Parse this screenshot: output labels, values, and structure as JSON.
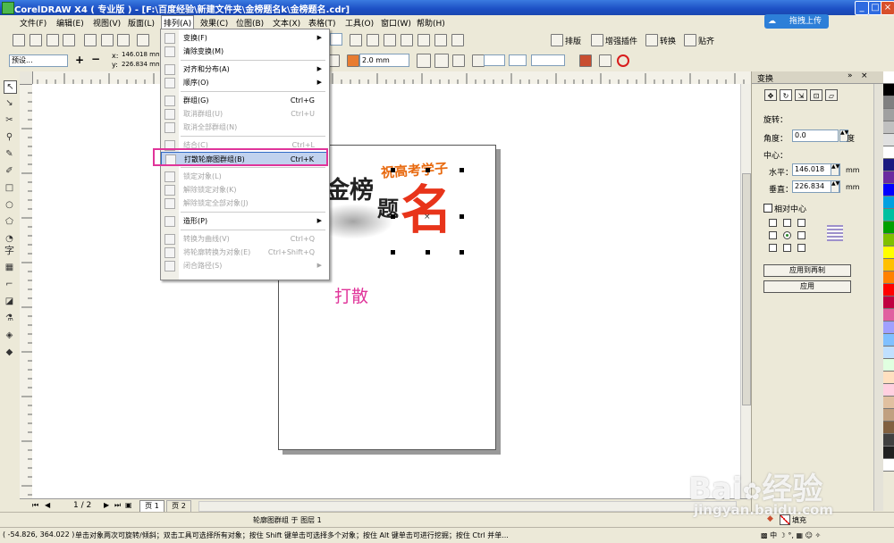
{
  "window": {
    "title": "CorelDRAW X4 ( 专业版 ) - [F:\\百度经验\\新建文件夹\\金榜题名k\\金榜题名.cdr]",
    "upload_label": "拖拽上传"
  },
  "menubar": [
    {
      "label": "文件(F)"
    },
    {
      "label": "编辑(E)"
    },
    {
      "label": "视图(V)"
    },
    {
      "label": "版面(L)"
    },
    {
      "label": "排列(A)"
    },
    {
      "label": "效果(C)"
    },
    {
      "label": "位图(B)"
    },
    {
      "label": "文本(X)"
    },
    {
      "label": "表格(T)"
    },
    {
      "label": "工具(O)"
    },
    {
      "label": "窗口(W)"
    },
    {
      "label": "帮助(H)"
    }
  ],
  "toolbar": {
    "right_buttons": [
      {
        "label": "排版"
      },
      {
        "label": "增强插件"
      },
      {
        "label": "转换"
      },
      {
        "label": "贴齐"
      }
    ],
    "preset_value": "预设...",
    "x_label": "x:",
    "x_value": "146.018 mm",
    "y_label": "y:",
    "y_value": "226.834 mm",
    "outline_value": "2.0 mm"
  },
  "arrange_menu": {
    "items": [
      {
        "label": "变换(F)",
        "shortcut": "",
        "submenu": true,
        "disabled": false
      },
      {
        "label": "清除变换(M)",
        "shortcut": "",
        "submenu": false,
        "disabled": false
      },
      {
        "sep": true
      },
      {
        "label": "对齐和分布(A)",
        "shortcut": "",
        "submenu": true,
        "disabled": false
      },
      {
        "label": "顺序(O)",
        "shortcut": "",
        "submenu": true,
        "disabled": false
      },
      {
        "sep": true
      },
      {
        "label": "群组(G)",
        "shortcut": "Ctrl+G",
        "submenu": false,
        "disabled": false
      },
      {
        "label": "取消群组(U)",
        "shortcut": "Ctrl+U",
        "submenu": false,
        "disabled": true
      },
      {
        "label": "取消全部群组(N)",
        "shortcut": "",
        "submenu": false,
        "disabled": true
      },
      {
        "sep": true
      },
      {
        "label": "结合(C)",
        "shortcut": "Ctrl+L",
        "submenu": false,
        "disabled": true
      },
      {
        "label": "打散轮廓图群组(B)",
        "shortcut": "Ctrl+K",
        "submenu": false,
        "disabled": false,
        "highlighted": true
      },
      {
        "sep": true
      },
      {
        "label": "锁定对象(L)",
        "shortcut": "",
        "submenu": false,
        "disabled": true
      },
      {
        "label": "解除锁定对象(K)",
        "shortcut": "",
        "submenu": false,
        "disabled": true
      },
      {
        "label": "解除锁定全部对象(J)",
        "shortcut": "",
        "submenu": false,
        "disabled": true
      },
      {
        "sep": true
      },
      {
        "label": "造形(P)",
        "shortcut": "",
        "submenu": true,
        "disabled": false
      },
      {
        "sep": true
      },
      {
        "label": "转换为曲线(V)",
        "shortcut": "Ctrl+Q",
        "submenu": false,
        "disabled": true
      },
      {
        "label": "将轮廓转换为对象(E)",
        "shortcut": "Ctrl+Shift+Q",
        "submenu": false,
        "disabled": true
      },
      {
        "label": "闭合路径(S)",
        "shortcut": "",
        "submenu": true,
        "disabled": true
      }
    ]
  },
  "artwork": {
    "chars_left": "金榜",
    "char_ti": "题",
    "char_ming": "名",
    "slogan": "祝高考学子",
    "annotation": "打散"
  },
  "docker": {
    "title": "变换",
    "rotate_label": "旋转：",
    "angle_label": "角度：",
    "angle_value": "0.0",
    "angle_unit": "度",
    "center_label": "中心：",
    "h_label": "水平：",
    "h_value": "146.018",
    "h_unit": "mm",
    "v_label": "垂直：",
    "v_value": "226.834",
    "v_unit": "mm",
    "relative_center_label": "相对中心",
    "apply_copy_label": "应用到再制",
    "apply_label": "应用"
  },
  "pager": {
    "counter": "1 / 2",
    "tabs": [
      "页 1",
      "页 2"
    ]
  },
  "status": {
    "object_info": "轮廓图群组 于 图层 1",
    "fill_label": "填充",
    "coords": "( -54.826, 364.022 )",
    "hint": "单击对象两次可旋转/倾斜；双击工具可选择所有对象；按住 Shift 键单击可选择多个对象；按住 Alt 键单击可进行挖掘；按住 Ctrl 并单..."
  },
  "watermark": {
    "brand": "Bai",
    "brand_cn": "经验",
    "url": "jingyan.baidu.com"
  },
  "colors": {
    "accent": "#316ac5",
    "annotation": "#e0349a",
    "slogan": "#e86a10",
    "ming": "#e8341a",
    "palette": [
      "#ffffff",
      "#000000",
      "#808080",
      "#a0a0a0",
      "#c0c0c0",
      "#e0e0e0",
      "#ffffff",
      "#1a1a80",
      "#6a2aa0",
      "#0000ff",
      "#00a0e0",
      "#00c0a0",
      "#00a000",
      "#80c000",
      "#ffff00",
      "#ffc000",
      "#ff8000",
      "#ff0000",
      "#c00040",
      "#e060a0",
      "#a0a0ff",
      "#80c0ff",
      "#c0e0ff",
      "#e0ffe0",
      "#ffe0c0",
      "#ffd0e0",
      "#e0c0a0",
      "#c0a080",
      "#806040",
      "#404040",
      "#202020",
      "#ffffff"
    ]
  }
}
